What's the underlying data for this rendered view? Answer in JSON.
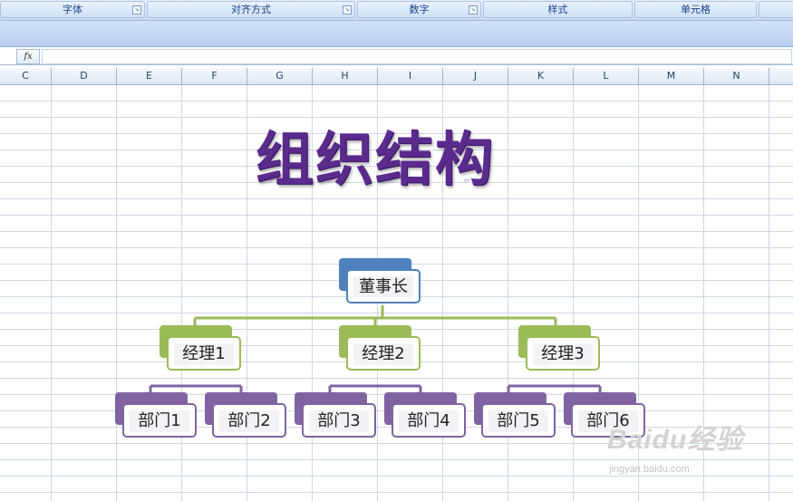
{
  "ribbon": {
    "groups": [
      "字体",
      "对齐方式",
      "数字",
      "样式",
      "单元格"
    ]
  },
  "formula_bar": {
    "fx_label": "fx",
    "value": ""
  },
  "columns": [
    "C",
    "D",
    "E",
    "F",
    "G",
    "H",
    "I",
    "J",
    "K",
    "L",
    "M",
    "N"
  ],
  "smartart": {
    "title": "组织结构",
    "root": "董事长",
    "managers": [
      "经理1",
      "经理2",
      "经理3"
    ],
    "departments": [
      "部门1",
      "部门2",
      "部门3",
      "部门4",
      "部门5",
      "部门6"
    ],
    "colors": {
      "root": "#4f81bd",
      "manager": "#9bbb59",
      "department": "#8064a2",
      "title": "#5a2a8c"
    }
  },
  "watermark": {
    "logo": "Baidu经验",
    "url": "jingyan.baidu.com"
  }
}
